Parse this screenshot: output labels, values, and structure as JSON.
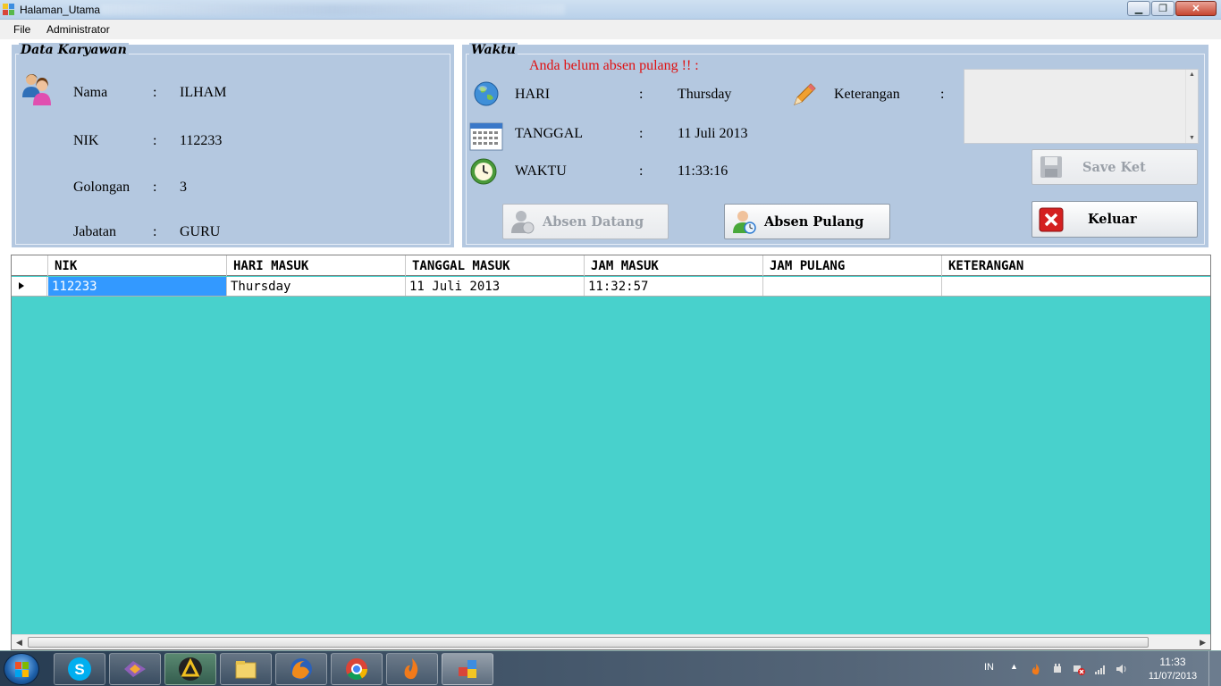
{
  "window": {
    "title": "Halaman_Utama",
    "controls": {
      "minimize": "▁",
      "maximize": "❐",
      "close": "✕"
    }
  },
  "menu": [
    "File",
    "Administrator"
  ],
  "employee_panel": {
    "title": "Data Karyawan",
    "fields": [
      {
        "label": "Nama",
        "sep": ":",
        "value": "ILHAM"
      },
      {
        "label": "NIK",
        "sep": ":",
        "value": "112233"
      },
      {
        "label": "Golongan",
        "sep": ":",
        "value": "3"
      },
      {
        "label": "Jabatan",
        "sep": ":",
        "value": "GURU"
      }
    ]
  },
  "time_panel": {
    "title": "Waktu",
    "alert": "Anda belum absen pulang !! :",
    "alert_color": "#e01010",
    "hari": {
      "label": "HARI",
      "sep": ":",
      "value": "Thursday"
    },
    "tanggal": {
      "label": "TANGGAL",
      "sep": ":",
      "value": "11 Juli 2013"
    },
    "waktu": {
      "label": "WAKTU",
      "sep": ":",
      "value": "11:33:16"
    },
    "keterangan": {
      "label": "Keterangan",
      "sep": ":",
      "value": ""
    },
    "buttons": {
      "absen_datang": "Absen Datang",
      "absen_pulang": "Absen Pulang",
      "save_ket": "Save Ket",
      "keluar": "Keluar"
    }
  },
  "grid": {
    "columns": [
      "NIK",
      "HARI MASUK",
      "TANGGAL MASUK",
      "JAM MASUK",
      "JAM PULANG",
      "KETERANGAN"
    ],
    "rows": [
      [
        "112233",
        "Thursday",
        "11 Juli 2013",
        "11:32:57",
        "",
        ""
      ]
    ],
    "background": "#48d1cc",
    "selection_color": "#3399ff"
  },
  "taskbar": {
    "apps": [
      "skype",
      "visual-studio",
      "aimp",
      "file-explorer",
      "firefox",
      "chrome",
      "app-flame",
      "sql-app"
    ],
    "language": "IN",
    "time": "11:33",
    "date": "11/07/2013"
  }
}
